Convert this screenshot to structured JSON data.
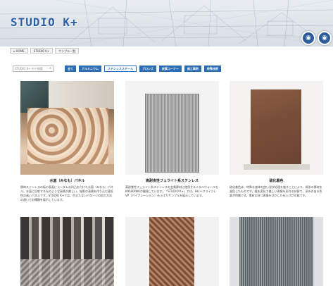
{
  "header": {
    "logo_text": "STUDIO K+",
    "buttons": [
      {
        "icon": "globe-icon",
        "glyph": "◉"
      },
      {
        "icon": "globe-icon",
        "glyph": "◉"
      }
    ]
  },
  "breadcrumb": {
    "items": [
      "HOME",
      "STUDIO K+",
      "サンプル一覧"
    ]
  },
  "filter": {
    "search_placeholder": "STUDIO K+ 内で検索",
    "tabs": [
      "全て",
      "アルミニウム",
      "ステンレススチール",
      "ブロンズ",
      "皮膜コーナー",
      "施工事例",
      "特殊技術"
    ],
    "active_tab_index": 2
  },
  "cards": [
    {
      "title": "水面（みなも）パネル",
      "desc": "厚肉ステンレスの板の表面にランダムな凹凸を付けた水面（みなも）パネル。水面に反射する光のような表情が美しい。陰影の表情を作り込む意匠性の高いパネルです。STUDIO K+では、目立たないパターンの加工方法の違いでの種類を展示しています。"
    },
    {
      "title": "高耐食性フェライト系ステンレス",
      "desc": "高耐食性フェライト系ステンレスを金属建材に使用するメタルウォールをKIKUKAWAが開発しています。「STUDIO K+」では、HL(ヘアライン)、VP（バイブレーション）仕上げたサンプルを展示しています。"
    },
    {
      "title": "硫化着色",
      "desc": "硫化着色は、特殊な液体を使い化学処理を施すことにより、銅系の素材を発色したものです。経年変化で美しい表情を形作る技術で、深みのある色調が特徴です。素材の持つ表情を活かした仕上げが可能です。"
    },
    {
      "title": "",
      "desc": ""
    },
    {
      "title": "",
      "desc": ""
    },
    {
      "title": "",
      "desc": ""
    }
  ],
  "colors": {
    "brand_blue": "#2b6cb3",
    "logo_blue": "#2a5fa8",
    "header_bg": "#dfe4ea"
  }
}
